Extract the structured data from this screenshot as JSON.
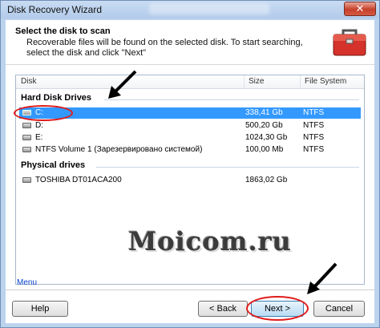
{
  "window": {
    "title": "Disk Recovery Wizard",
    "close_glyph": "✕"
  },
  "header": {
    "title": "Select the disk to scan",
    "description": "Recoverable files will be found on the selected disk. To start searching, select the disk and click \"Next\""
  },
  "list": {
    "columns": {
      "disk": "Disk",
      "size": "Size",
      "fs": "File System"
    },
    "groups": [
      {
        "title": "Hard Disk Drives",
        "items": [
          {
            "name": "C:",
            "size": "338,41 Gb",
            "fs": "NTFS",
            "selected": true
          },
          {
            "name": "D:",
            "size": "500,20 Gb",
            "fs": "NTFS"
          },
          {
            "name": "E:",
            "size": "1024,30 Gb",
            "fs": "NTFS"
          },
          {
            "name": "NTFS Volume 1 (Зарезервировано системой)",
            "size": "100,00 Mb",
            "fs": "NTFS"
          }
        ]
      },
      {
        "title": "Physical drives",
        "items": [
          {
            "name": "TOSHIBA DT01ACA200",
            "size": "1863,02 Gb",
            "fs": ""
          }
        ]
      }
    ]
  },
  "watermark": "Moicom.ru",
  "menu_link": "Menu",
  "buttons": {
    "help": "Help",
    "back": "< Back",
    "next": "Next >",
    "cancel": "Cancel"
  },
  "colors": {
    "selection": "#3399ff",
    "highlight": "#e11a1a",
    "link": "#0a43c8"
  }
}
